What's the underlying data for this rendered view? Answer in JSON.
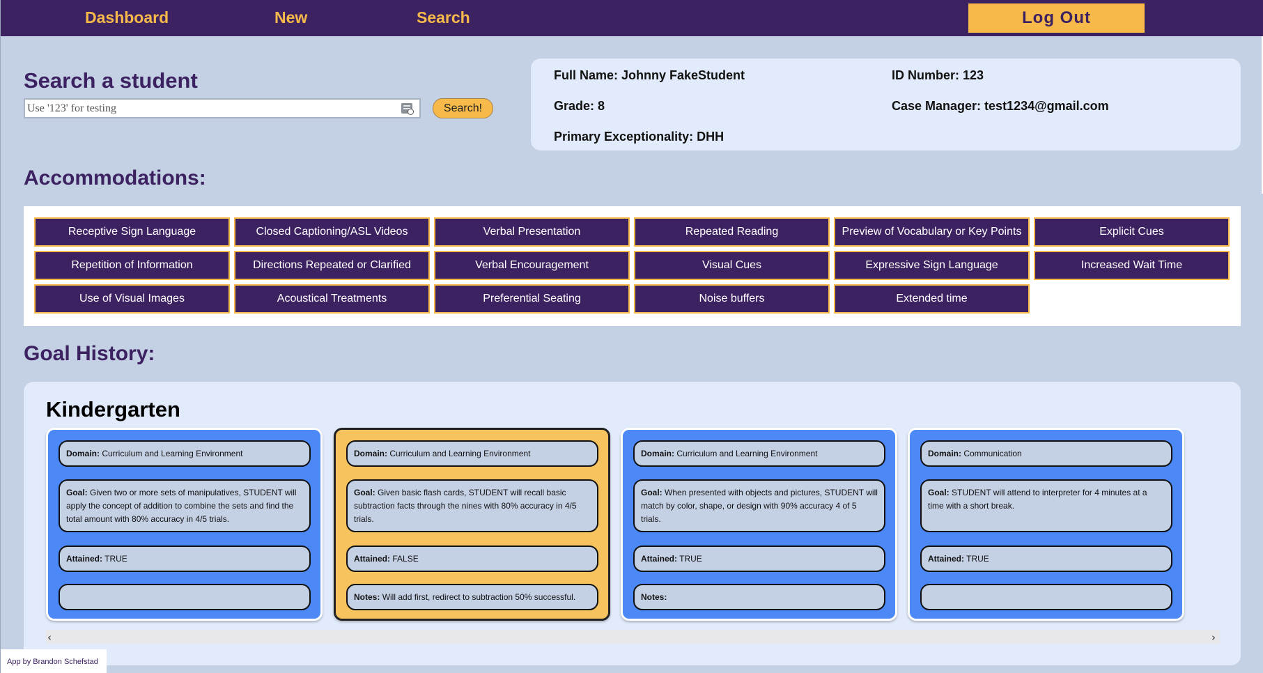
{
  "nav": {
    "dashboard": "Dashboard",
    "new": "New",
    "search": "Search",
    "logout": "Log Out"
  },
  "search": {
    "title": "Search a student",
    "placeholder": "Use '123' for testing",
    "button": "Search!"
  },
  "student": {
    "full_name": "Full Name: Johnny FakeStudent",
    "id_number": "ID Number: 123",
    "grade": "Grade: 8",
    "case_manager": "Case Manager: test1234@gmail.com",
    "primary_exceptionality": "Primary Exceptionality: DHH"
  },
  "accommodations": {
    "title": "Accommodations:",
    "items": [
      "Receptive Sign Language",
      "Closed Captioning/ASL Videos",
      "Verbal Presentation",
      "Repeated Reading",
      "Preview of Vocabulary or Key Points",
      "Explicit Cues",
      "Repetition of Information",
      "Directions Repeated or Clarified",
      "Verbal Encouragement",
      "Visual Cues",
      "Expressive Sign Language",
      "Increased Wait Time",
      "Use of Visual Images",
      "Acoustical Treatments",
      "Preferential Seating",
      "Noise buffers",
      "Extended time"
    ]
  },
  "goal_history": {
    "title": "Goal History:",
    "grade": "Kindergarten",
    "labels": {
      "domain": "Domain:",
      "goal": "Goal:",
      "attained": "Attained:",
      "notes": "Notes:"
    },
    "goals": [
      {
        "color": "blue",
        "domain": "Curriculum and Learning Environment",
        "goal": "Given two or more sets of manipulatives, STUDENT will apply the concept of addition to combine the sets and find the total amount with 80% accuracy in 4/5 trials.",
        "attained": "TRUE",
        "notes": "",
        "show_notes_label": false
      },
      {
        "color": "gold",
        "domain": "Curriculum and Learning Environment",
        "goal": "Given basic flash cards, STUDENT will recall basic subtraction facts through the nines with 80% accuracy in 4/5 trials.",
        "attained": "FALSE",
        "notes": "Will add first, redirect to subtraction 50% successful.",
        "show_notes_label": true
      },
      {
        "color": "blue",
        "domain": "Curriculum and Learning Environment",
        "goal": "When presented with objects and pictures, STUDENT will match by color, shape, or design with 90% accuracy 4 of 5 trials.",
        "attained": "TRUE",
        "notes": "",
        "show_notes_label": true
      },
      {
        "color": "blue",
        "domain": "Communication",
        "goal": "STUDENT will attend to interpreter for 4 minutes at a time with a short break.",
        "attained": "TRUE",
        "notes": "",
        "show_notes_label": false
      }
    ]
  },
  "footer": {
    "credit": "App by Brandon Schefstad"
  },
  "colors": {
    "nav_bg": "#3d2261",
    "accent_gold": "#f6b94a",
    "page_bg": "#c4d0e4",
    "card_blue": "#4d88f7"
  },
  "icons": {
    "search_field_icon": "keyboard-icon",
    "scroll_left": "chevron-left-icon",
    "scroll_right": "chevron-right-icon"
  }
}
